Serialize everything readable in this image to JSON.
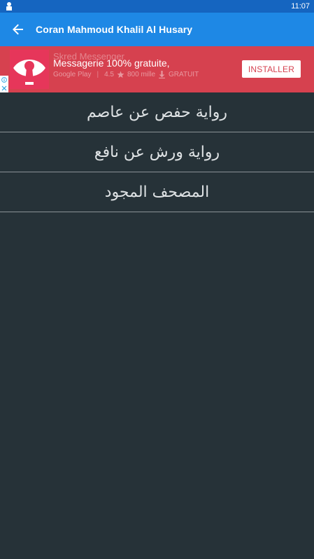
{
  "status_bar": {
    "time": "11:07",
    "notification_icon": "person-icon"
  },
  "app_bar": {
    "title": "Coran Mahmoud Khalil Al Husary",
    "back_icon": "arrow-left-icon",
    "background": "#1e88e5"
  },
  "ad": {
    "app_name": "Skred Messenger",
    "headline": "Messagerie 100% gratuite,",
    "store": "Google Play",
    "rating": "4.5",
    "downloads": "800 mille",
    "price": "GRATUIT",
    "install_label": "INSTALLER",
    "background": "#d6414f"
  },
  "menu": {
    "items": [
      {
        "label": "رواية حفص عن عاصم"
      },
      {
        "label": "رواية ورش عن نافع"
      },
      {
        "label": "المصحف المجود"
      }
    ]
  },
  "colors": {
    "page_background": "#263238",
    "status_bar": "#1565c0",
    "divider": "#8a9296"
  }
}
